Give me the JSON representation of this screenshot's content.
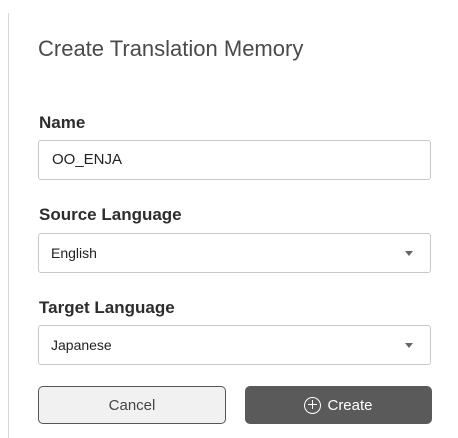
{
  "dialog": {
    "title": "Create Translation Memory"
  },
  "fields": {
    "name": {
      "label": "Name",
      "value": "OO_ENJA"
    },
    "source_language": {
      "label": "Source Language",
      "value": "English"
    },
    "target_language": {
      "label": "Target Language",
      "value": "Japanese"
    }
  },
  "buttons": {
    "cancel": "Cancel",
    "create": "Create"
  },
  "icons": {
    "create_button_icon": "plus-circle-icon",
    "dropdown_icon": "chevron-down-icon"
  },
  "colors": {
    "primary_button": "#5a5a5a",
    "secondary_button": "#f1f1f1",
    "field_border": "#c9c9c9",
    "text": "#222222"
  }
}
